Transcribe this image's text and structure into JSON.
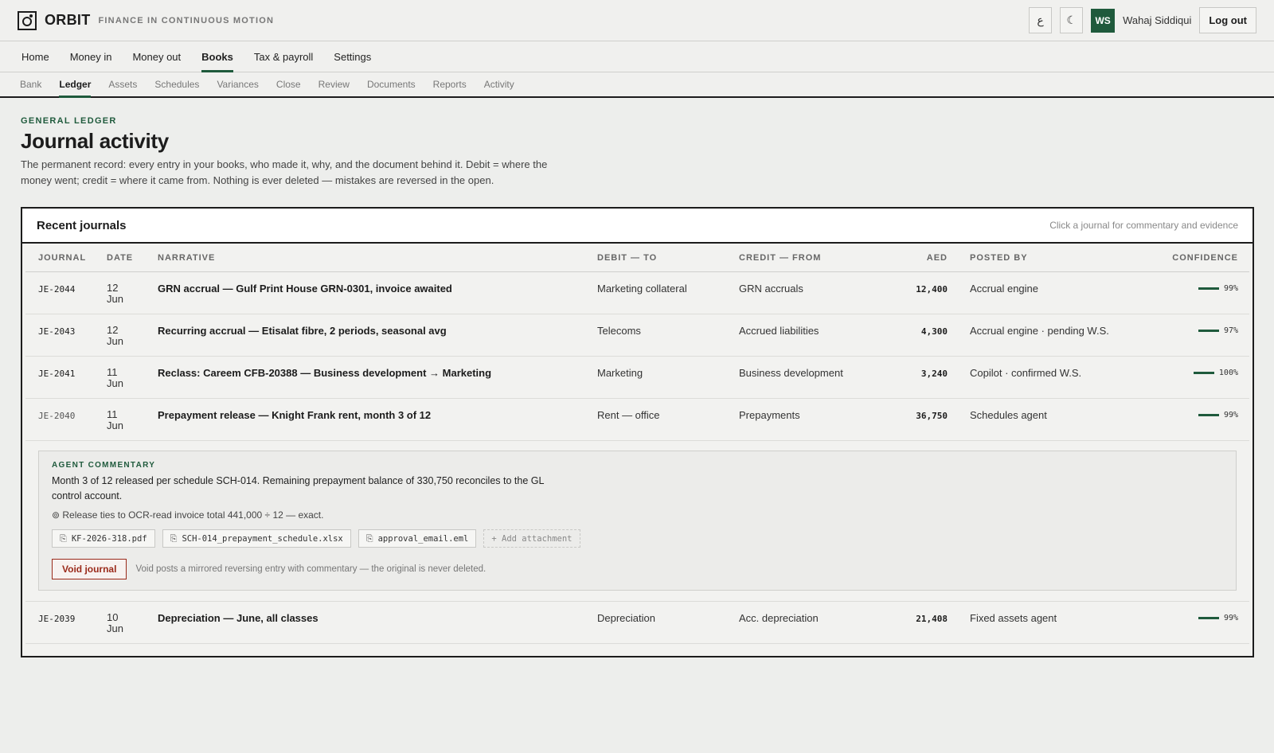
{
  "app": {
    "brand": "ORBIT",
    "tagline": "FINANCE IN CONTINUOUS MOTION",
    "lang_toggle_glyph": "ع",
    "theme_toggle_glyph": "☾",
    "user_initials": "WS",
    "user_name": "Wahaj Siddiqui",
    "logout_label": "Log out"
  },
  "nav_primary": [
    "Home",
    "Money in",
    "Money out",
    "Books",
    "Tax & payroll",
    "Settings"
  ],
  "nav_primary_active": "Books",
  "nav_secondary": [
    "Bank",
    "Ledger",
    "Assets",
    "Schedules",
    "Variances",
    "Close",
    "Review",
    "Documents",
    "Reports",
    "Activity"
  ],
  "nav_secondary_active": "Ledger",
  "header": {
    "eyebrow": "GENERAL LEDGER",
    "title": "Journal activity",
    "description": "The permanent record: every entry in your books, who made it, why, and the document behind it. Debit = where the money went; credit = where it came from. Nothing is ever deleted — mistakes are reversed in the open."
  },
  "panel": {
    "title": "Recent journals",
    "hint": "Click a journal for commentary and evidence",
    "columns": {
      "journal": "JOURNAL",
      "date": "DATE",
      "narrative": "NARRATIVE",
      "debit": "DEBIT — TO",
      "credit": "CREDIT — FROM",
      "amount": "AED",
      "posted_by": "POSTED BY",
      "confidence": "CONFIDENCE"
    },
    "rows": [
      {
        "id": "JE-2044",
        "day": "12",
        "month": "Jun",
        "narrative": "GRN accrual — Gulf Print House GRN-0301, invoice awaited",
        "debit": "Marketing collateral",
        "credit": "GRN accruals",
        "amount": "12,400",
        "posted_by": "Accrual engine",
        "confidence": "99%",
        "confidence_value": 99
      },
      {
        "id": "JE-2043",
        "day": "12",
        "month": "Jun",
        "narrative": "Recurring accrual — Etisalat fibre, 2 periods, seasonal avg",
        "debit": "Telecoms",
        "credit": "Accrued liabilities",
        "amount": "4,300",
        "posted_by": "Accrual engine · pending W.S.",
        "confidence": "97%",
        "confidence_value": 97
      },
      {
        "id": "JE-2041",
        "day": "11",
        "month": "Jun",
        "narrative": "Reclass: Careem CFB-20388 — Business development → Marketing",
        "debit": "Marketing",
        "credit": "Business development",
        "amount": "3,240",
        "posted_by": "Copilot · confirmed W.S.",
        "confidence": "100%",
        "confidence_value": 100
      },
      {
        "id": "JE-2040",
        "day": "11",
        "month": "Jun",
        "narrative": "Prepayment release — Knight Frank rent, month 3 of 12",
        "debit": "Rent — office",
        "credit": "Prepayments",
        "amount": "36,750",
        "posted_by": "Schedules agent",
        "confidence": "99%",
        "confidence_value": 99
      },
      {
        "id": "JE-2039",
        "day": "10",
        "month": "Jun",
        "narrative": "Depreciation — June, all classes",
        "debit": "Depreciation",
        "credit": "Acc. depreciation",
        "amount": "21,408",
        "posted_by": "Fixed assets agent",
        "confidence": "99%",
        "confidence_value": 99
      }
    ],
    "commentary": {
      "label": "AGENT COMMENTARY",
      "body": "Month 3 of 12 released per schedule SCH-014. Remaining prepayment balance of 330,750 reconciles to the GL control account.",
      "check": "⊚ Release ties to OCR-read invoice total 441,000 ÷ 12 — exact.",
      "attachments": [
        "KF-2026-318.pdf",
        "SCH-014_prepayment_schedule.xlsx",
        "approval_email.eml"
      ],
      "add_attachment": "+ Add attachment",
      "void_label": "Void journal",
      "void_note": "Void posts a mirrored reversing entry with commentary — the original is never deleted."
    }
  }
}
